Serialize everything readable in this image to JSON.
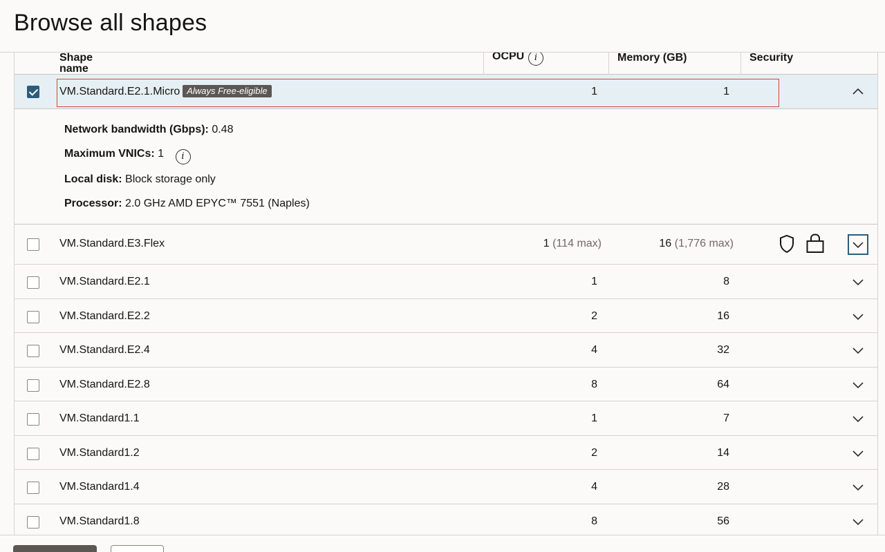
{
  "page": {
    "title": "Browse all shapes"
  },
  "table": {
    "columns": {
      "name": "Shape name",
      "ocpu": "OCPU",
      "memory": "Memory (GB)",
      "security": "Security"
    },
    "selected_row": {
      "name": "VM.Standard.E2.1.Micro",
      "badge": "Always Free-eligible",
      "ocpu": "1",
      "memory": "1",
      "checked": true,
      "details": {
        "bandwidth_label": "Network bandwidth (Gbps):",
        "bandwidth_value": "0.48",
        "vnics_label": "Maximum VNICs:",
        "vnics_value": "1",
        "disk_label": "Local disk:",
        "disk_value": "Block storage only",
        "processor_label": "Processor:",
        "processor_value": "2.0 GHz AMD EPYC™ 7551 (Naples)"
      }
    },
    "flex_row": {
      "name": "VM.Standard.E3.Flex",
      "ocpu": "1",
      "ocpu_max": "(114 max)",
      "memory": "16",
      "memory_max": "(1,776 max)",
      "security_icons": [
        "shield-icon",
        "lock-icon"
      ]
    },
    "rows": [
      {
        "name": "VM.Standard.E2.1",
        "ocpu": "1",
        "memory": "8"
      },
      {
        "name": "VM.Standard.E2.2",
        "ocpu": "2",
        "memory": "16"
      },
      {
        "name": "VM.Standard.E2.4",
        "ocpu": "4",
        "memory": "32"
      },
      {
        "name": "VM.Standard.E2.8",
        "ocpu": "8",
        "memory": "64"
      },
      {
        "name": "VM.Standard1.1",
        "ocpu": "1",
        "memory": "7"
      },
      {
        "name": "VM.Standard1.2",
        "ocpu": "2",
        "memory": "14"
      },
      {
        "name": "VM.Standard1.4",
        "ocpu": "4",
        "memory": "28"
      },
      {
        "name": "VM.Standard1.8",
        "ocpu": "8",
        "memory": "56"
      }
    ]
  },
  "colors": {
    "accent": "#2c5c7c",
    "badge_bg": "#5c5753",
    "selected_bg": "#e6eff3",
    "focus": "#d0473b"
  }
}
